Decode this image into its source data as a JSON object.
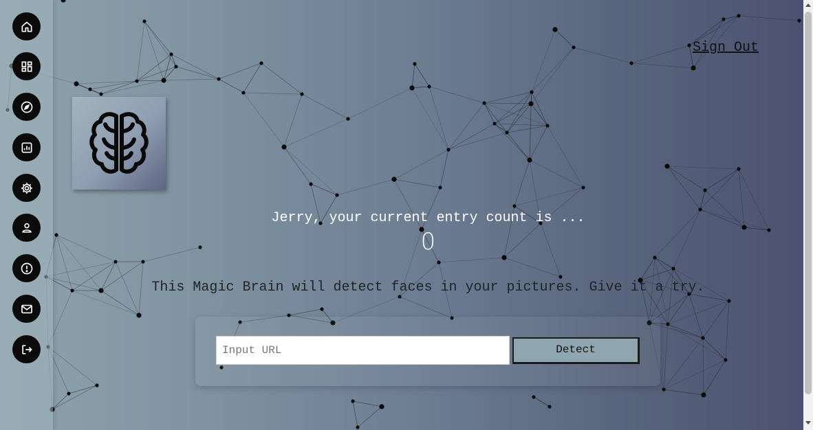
{
  "header": {
    "sign_out_label": "Sign Out"
  },
  "sidebar": {
    "items": [
      {
        "name": "home",
        "icon": "home-icon"
      },
      {
        "name": "dashboard",
        "icon": "dashboard-icon"
      },
      {
        "name": "explore",
        "icon": "compass-icon"
      },
      {
        "name": "analytics",
        "icon": "chart-icon"
      },
      {
        "name": "settings",
        "icon": "gear-icon"
      },
      {
        "name": "profile",
        "icon": "user-icon"
      },
      {
        "name": "info",
        "icon": "alert-icon"
      },
      {
        "name": "messages",
        "icon": "mail-icon"
      },
      {
        "name": "logout",
        "icon": "logout-icon"
      }
    ]
  },
  "logo": {
    "icon": "brain-icon"
  },
  "rank": {
    "label": "Jerry, your current entry count is ...",
    "count": "0"
  },
  "tagline": "This Magic Brain will detect faces in your pictures. Give it a try.",
  "form": {
    "input_placeholder": "Input URL",
    "input_value": "",
    "button_label": "Detect"
  },
  "colors": {
    "background_start": "#8fa3ad",
    "background_end": "#4a5170",
    "button": "#8fa6b0",
    "nav_button": "#0b0b0b"
  }
}
